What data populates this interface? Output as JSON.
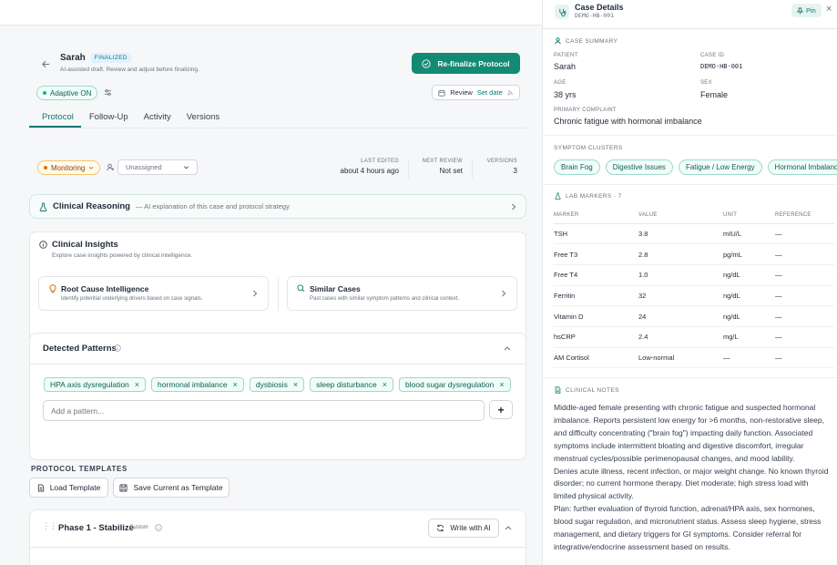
{
  "case": {
    "patient_name": "Sarah",
    "status_badge": "FINALIZED",
    "subtitle": "AI-assisted draft. Review and adjust before finalizing.",
    "refinalize_label": "Re-finalize Protocol",
    "adaptive_label": "Adaptive ON",
    "review_label": "Review",
    "set_date_label": "Set date"
  },
  "tabs": [
    {
      "label": "Protocol"
    },
    {
      "label": "Follow-Up"
    },
    {
      "label": "Activity"
    },
    {
      "label": "Versions"
    }
  ],
  "status_row": {
    "monitoring_label": "Monitoring",
    "assignee_value": "Unassigned",
    "last_edited_label": "LAST EDITED",
    "last_edited_value": "about 4 hours ago",
    "next_review_label": "NEXT REVIEW",
    "next_review_value": "Not set",
    "versions_label": "VERSIONS",
    "versions_value": "3"
  },
  "reasoning": {
    "title": "Clinical Reasoning",
    "subtitle": "— AI explanation of this case and protocol strategy"
  },
  "insights": {
    "title": "Clinical Insights",
    "subtitle": "Explore case insights powered by clinical intelligence.",
    "root_cause_title": "Root Cause Intelligence",
    "root_cause_desc": "Identify potential underlying drivers based on case signals.",
    "similar_title": "Similar Cases",
    "similar_desc": "Past cases with similar symptom patterns and clinical context."
  },
  "patterns": {
    "title": "Detected Patterns",
    "tags": [
      {
        "label": "HPA axis dysregulation"
      },
      {
        "label": "hormonal imbalance"
      },
      {
        "label": "dysbiosis"
      },
      {
        "label": "sleep disturbance"
      },
      {
        "label": "blood sugar dysregulation"
      }
    ],
    "add_placeholder": "Add a pattern..."
  },
  "templates": {
    "heading": "PROTOCOL TEMPLATES",
    "load_label": "Load Template",
    "save_label": "Save Current as Template"
  },
  "phase": {
    "title": "Phase 1 - Stabilize",
    "badge": "Custom",
    "write_ai_label": "Write with AI"
  },
  "panel": {
    "title": "Case Details",
    "case_code": "DEMO-HB-001",
    "pin_label": "Pin",
    "summary_heading": "CASE SUMMARY",
    "patient_label": "PATIENT",
    "patient_value": "Sarah",
    "case_id_label": "CASE ID",
    "case_id_value": "DEMO-HB-001",
    "age_label": "AGE",
    "age_value": "38 yrs",
    "sex_label": "SEX",
    "sex_value": "Female",
    "complaint_label": "PRIMARY COMPLAINT",
    "complaint_value": "Chronic fatigue with hormonal imbalance",
    "clusters_heading": "SYMPTOM CLUSTERS",
    "clusters": [
      {
        "label": "Brain Fog"
      },
      {
        "label": "Digestive Issues"
      },
      {
        "label": "Fatigue / Low Energy"
      },
      {
        "label": "Hormonal Imbalance"
      }
    ],
    "labs_heading": "LAB MARKERS · 7",
    "labs_columns": [
      "MARKER",
      "VALUE",
      "UNIT",
      "REFERENCE"
    ],
    "labs": [
      {
        "marker": "TSH",
        "value": "3.8",
        "unit": "mIU/L",
        "reference": "—"
      },
      {
        "marker": "Free T3",
        "value": "2.8",
        "unit": "pg/mL",
        "reference": "—"
      },
      {
        "marker": "Free T4",
        "value": "1.0",
        "unit": "ng/dL",
        "reference": "—"
      },
      {
        "marker": "Ferritin",
        "value": "32",
        "unit": "ng/dL",
        "reference": "—"
      },
      {
        "marker": "Vitamin D",
        "value": "24",
        "unit": "ng/dL",
        "reference": "—"
      },
      {
        "marker": "hsCRP",
        "value": "2.4",
        "unit": "mg/L",
        "reference": "—"
      },
      {
        "marker": "AM Cortisol",
        "value": "Low-normal",
        "unit": "—",
        "reference": "—"
      }
    ],
    "notes_heading": "CLINICAL NOTES",
    "notes_p1": "Middle-aged female presenting with chronic fatigue and suspected hormonal imbalance. Reports persistent low energy for >6 months, non-restorative sleep, and difficulty concentrating (\"brain fog\") impacting daily function. Associated symptoms include intermittent bloating and digestive discomfort, irregular menstrual cycles/possible perimenopausal changes, and mood lability.",
    "notes_p2": "Denies acute illness, recent infection, or major weight change. No known thyroid disorder; no current hormone therapy. Diet moderate; high stress load with limited physical activity.",
    "notes_p3": "Plan: further evaluation of thyroid function, adrenal/HPA axis, sex hormones, blood sugar regulation, and micronutrient status. Assess sleep hygiene, stress management, and dietary triggers for GI symptoms. Consider referral for integrative/endocrine assessment based on results."
  },
  "colors": {
    "accent": "#0f766e",
    "accent_button": "#138a74",
    "monitoring": "#d97706"
  }
}
